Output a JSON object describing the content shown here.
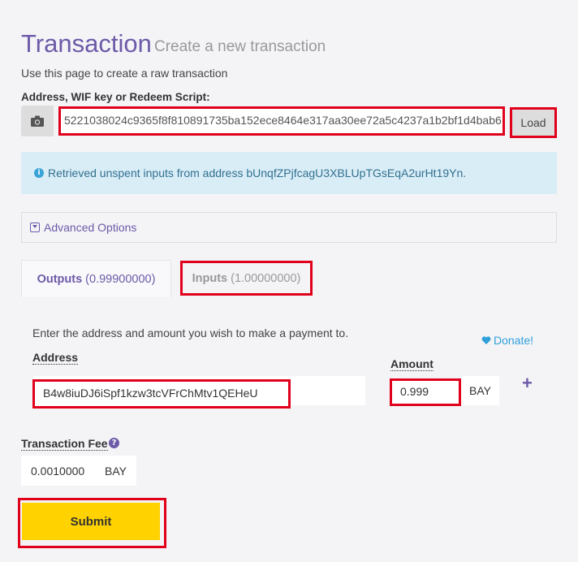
{
  "header": {
    "title": "Transaction",
    "subtitle": "Create a new transaction",
    "description": "Use this page to create a raw transaction"
  },
  "script_section": {
    "label": "Address, WIF key or Redeem Script:",
    "value": "5221038024c9365f8f810891735ba152ece8464e317aa30ee72a5c4237a1b2bf1d4bab6",
    "camera_icon": "camera-icon",
    "load_label": "Load"
  },
  "alert": {
    "icon": "info-icon",
    "text": "Retrieved unspent inputs from address bUnqfZPjfcagU3XBLUpTGsEqA2urHt19Yn."
  },
  "advanced": {
    "icon": "caret-square-down-icon",
    "label": "Advanced Options"
  },
  "tabs": {
    "outputs_label": "Outputs",
    "outputs_amount": "(0.99900000)",
    "inputs_label": "Inputs",
    "inputs_amount": "(1.00000000)"
  },
  "outputs": {
    "instruction": "Enter the address and amount you wish to make a payment to.",
    "donate_label": "Donate!",
    "address_label": "Address",
    "amount_label": "Amount",
    "address_value": "B4w8iuDJ6iSpf1kzw3tcVFrChMtv1QEHeU",
    "amount_value": "0.999",
    "amount_unit": "BAY",
    "add_icon": "plus-icon"
  },
  "fee": {
    "label": "Transaction Fee",
    "help_icon": "question-circle-icon",
    "value": "0.0010000",
    "unit": "BAY"
  },
  "submit_label": "Submit",
  "colors": {
    "accent": "#6d5aa8",
    "highlight": "#e0001b",
    "submit": "#ffd200",
    "alert_bg": "#d9edf7",
    "link": "#2fa0da"
  }
}
